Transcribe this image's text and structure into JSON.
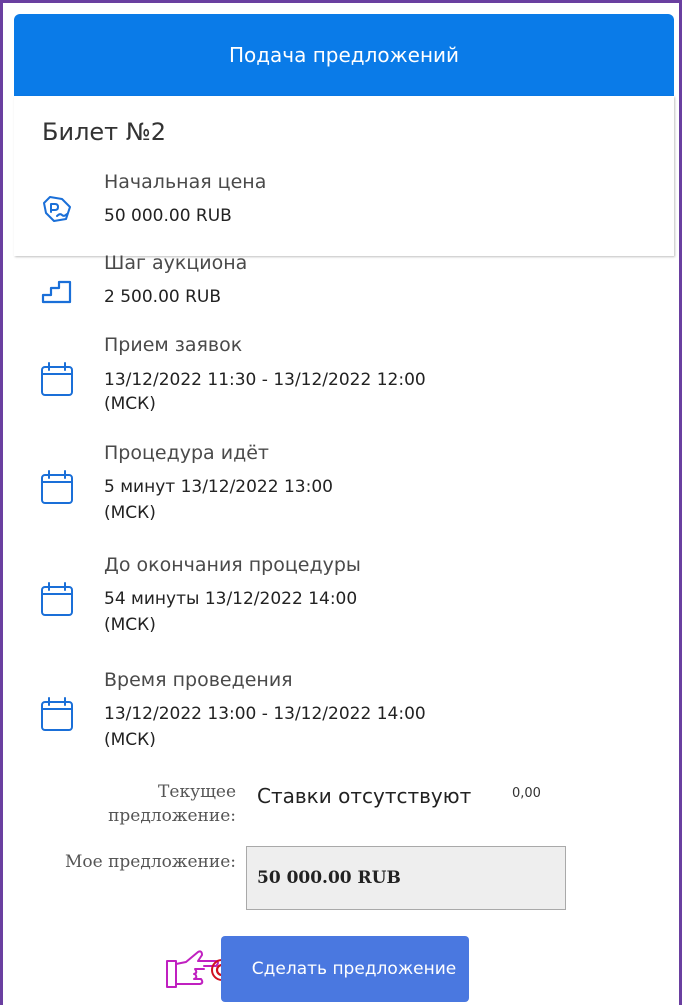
{
  "header": {
    "title": "Подача предложений"
  },
  "ticket": {
    "title": "Билет №2"
  },
  "details": {
    "start_price": {
      "label": "Начальная цена",
      "value": "50 000.00 RUB",
      "icon": "price-tag-icon"
    },
    "auction_step": {
      "label": "Шаг аукциона",
      "value": "2 500.00 RUB",
      "icon": "stairs-icon"
    },
    "applications": {
      "label": "Прием заявок",
      "value_line1": "13/12/2022 11:30  - 13/12/2022 12:00",
      "value_line2": "(МСК)",
      "icon": "calendar-icon"
    },
    "procedure_running": {
      "label": "Процедура идёт",
      "value_line1": "5 минут 13/12/2022 13:00",
      "value_line2": "(МСК)",
      "icon": "calendar-icon"
    },
    "until_end": {
      "label": "До окончания процедуры",
      "value_line1": "54 минуты 13/12/2022 14:00",
      "value_line2": "(МСК)",
      "icon": "calendar-icon"
    },
    "duration": {
      "label": "Время проведения",
      "value_line1": "13/12/2022 13:00 - 13/12/2022 14:00",
      "value_line2": "(МСК)",
      "icon": "calendar-icon"
    }
  },
  "bidding": {
    "current_label_line1": "Текущее",
    "current_label_line2": "предложение:",
    "current_value": "Ставки отсутствуют",
    "current_amount": "0,00",
    "my_label": "Мое предложение:",
    "my_value": "50 000.00 RUB",
    "submit_label": "Сделать предложение"
  },
  "colors": {
    "header_bg": "#0a7be8",
    "accent": "#1a6fd8",
    "button_bg": "#4a78e0",
    "frame": "#6a3fa0",
    "pointer": "#c020c0"
  }
}
